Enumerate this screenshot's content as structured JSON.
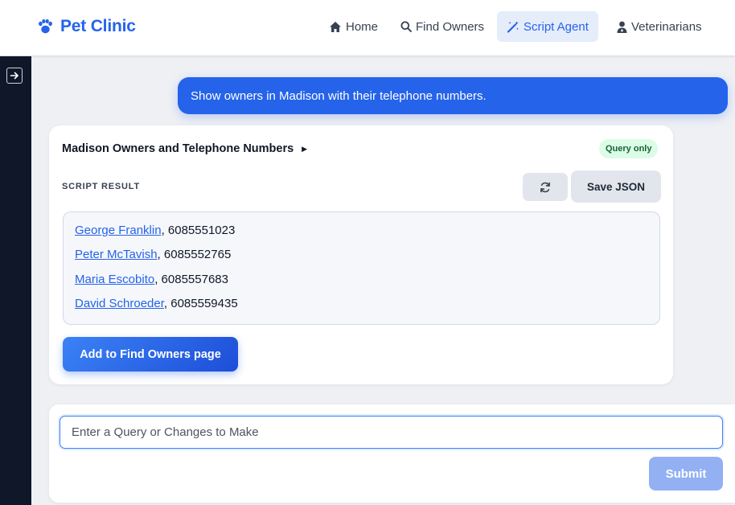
{
  "app": {
    "brand": "Pet Clinic"
  },
  "nav": {
    "home": "Home",
    "find_owners": "Find Owners",
    "script_agent": "Script Agent",
    "veterinarians": "Veterinarians"
  },
  "chat": {
    "user_message": "Show owners in Madison with their telephone numbers."
  },
  "result_card": {
    "title": "Madison Owners and Telephone Numbers",
    "badge": "Query only",
    "section_label": "SCRIPT RESULT",
    "save_label": "Save JSON",
    "rows": [
      {
        "name": "George Franklin",
        "phone": ", 6085551023"
      },
      {
        "name": "Peter McTavish",
        "phone": ", 6085552765"
      },
      {
        "name": "Maria Escobito",
        "phone": ", 6085557683"
      },
      {
        "name": "David Schroeder",
        "phone": ", 6085559435"
      }
    ],
    "add_label": "Add to Find Owners page"
  },
  "composer": {
    "placeholder": "Enter a Query or Changes to Make",
    "value": "",
    "submit_label": "Submit"
  },
  "colors": {
    "accent": "#2563eb",
    "sidebar": "#0f1728",
    "badge_bg": "#dcfce7",
    "badge_text": "#166534"
  },
  "icons": {
    "brand": "paw-icon",
    "home": "home-icon",
    "find_owners": "search-icon",
    "script_agent": "magic-wand-icon",
    "veterinarians": "user-doctor-icon",
    "sidebar": "arrow-right-icon",
    "refresh": "refresh-icon"
  }
}
